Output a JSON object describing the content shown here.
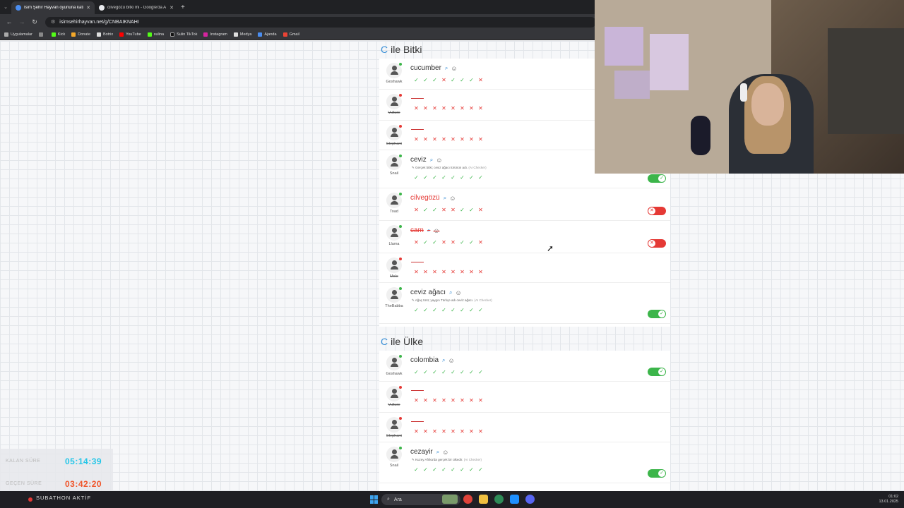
{
  "browser": {
    "tabs": [
      {
        "title": "İsim Şehir Hayvan oyununa katı",
        "active": true
      },
      {
        "title": "cilvegözü bitki mi - Google'da A",
        "active": false
      }
    ],
    "url": "isimsehirhayvan.net/g/CNBAIKNAHI",
    "bookmarks": [
      "Uygulamalar",
      "Kick",
      "Donate",
      "Botrix",
      "YouTube",
      "sulina",
      "Sulin TikTok",
      "Instagram",
      "Medya",
      "Ajanda",
      "Gmail"
    ]
  },
  "sections": [
    {
      "letter": "C",
      "title": "ile Bitki",
      "rows": [
        {
          "player": "Goshawk",
          "online": true,
          "answer": "cucumber",
          "style": "normal",
          "note": "",
          "votes": [
            "ok",
            "ok",
            "ok",
            "no",
            "ok",
            "ok",
            "ok",
            "no"
          ],
          "toggle": null,
          "struck": false
        },
        {
          "player": "Vulture",
          "online": false,
          "answer": "",
          "style": "empty",
          "note": "",
          "votes": [
            "no",
            "no",
            "no",
            "no",
            "no",
            "no",
            "no",
            "no"
          ],
          "toggle": null,
          "struck": true
        },
        {
          "player": "Elephant",
          "online": false,
          "answer": "",
          "style": "empty",
          "note": "",
          "votes": [
            "no",
            "no",
            "no",
            "no",
            "no",
            "no",
            "no",
            "no"
          ],
          "toggle": null,
          "struck": true
        },
        {
          "player": "Snail",
          "online": true,
          "answer": "ceviz",
          "style": "normal",
          "note": "Gerçek bitki; ceviz ağacı türünün adı.",
          "note_tag": "(AI Checker)",
          "votes": [
            "ok",
            "ok",
            "ok",
            "ok",
            "ok",
            "ok",
            "ok",
            "ok"
          ],
          "toggle": "on",
          "struck": false
        },
        {
          "player": "Toad",
          "online": true,
          "answer": "cilvegözü",
          "style": "red",
          "note": "",
          "votes": [
            "no",
            "ok",
            "ok",
            "no",
            "no",
            "ok",
            "ok",
            "no"
          ],
          "toggle": "off",
          "struck": false
        },
        {
          "player": "Llama",
          "online": true,
          "answer": "cam",
          "style": "strike",
          "note": "",
          "votes": [
            "no",
            "ok",
            "ok",
            "no",
            "no",
            "ok",
            "ok",
            "no"
          ],
          "toggle": "off",
          "struck": false
        },
        {
          "player": "Mole",
          "online": false,
          "answer": "",
          "style": "empty",
          "note": "",
          "votes": [
            "no",
            "no",
            "no",
            "no",
            "no",
            "no",
            "no",
            "no"
          ],
          "toggle": null,
          "struck": true
        },
        {
          "player": "TheBabba",
          "online": true,
          "answer": "ceviz ağacı",
          "style": "normal",
          "note": "Ağaç türü; yaygın Türkçe adı ceviz ağacı.",
          "note_tag": "(AI Checker)",
          "votes": [
            "ok",
            "ok",
            "ok",
            "ok",
            "ok",
            "ok",
            "ok",
            "ok"
          ],
          "toggle": "on",
          "struck": false
        }
      ]
    },
    {
      "letter": "C",
      "title": "ile Ülke",
      "rows": [
        {
          "player": "Goshawk",
          "online": true,
          "answer": "colombia",
          "style": "normal",
          "note": "",
          "votes": [
            "ok",
            "ok",
            "ok",
            "ok",
            "ok",
            "ok",
            "ok",
            "ok"
          ],
          "toggle": "on",
          "struck": false
        },
        {
          "player": "Vulture",
          "online": false,
          "answer": "",
          "style": "empty",
          "note": "",
          "votes": [
            "no",
            "no",
            "no",
            "no",
            "no",
            "no",
            "no",
            "no"
          ],
          "toggle": null,
          "struck": true
        },
        {
          "player": "Elephant",
          "online": false,
          "answer": "",
          "style": "empty",
          "note": "",
          "votes": [
            "no",
            "no",
            "no",
            "no",
            "no",
            "no",
            "no",
            "no"
          ],
          "toggle": null,
          "struck": true
        },
        {
          "player": "Snail",
          "online": true,
          "answer": "cezayir",
          "style": "normal",
          "note": "Kuzey Afrika'da gerçek bir ülkedir.",
          "note_tag": "(AI Checker)",
          "votes": [
            "ok",
            "ok",
            "ok",
            "ok",
            "ok",
            "ok",
            "ok",
            "ok"
          ],
          "toggle": "on",
          "struck": false
        }
      ]
    }
  ],
  "overlay": {
    "remaining_label": "KALAN SÜRE",
    "remaining_value": "05:14:39",
    "elapsed_label": "GEÇEN SÜRE",
    "elapsed_value": "03:42:20",
    "subathon": "SUBATHON AKTİF"
  },
  "taskbar": {
    "search_placeholder": "Ara",
    "time": "01:02",
    "date": "13.01.2025"
  },
  "colors": {
    "accent": "#3a8fd6",
    "ok": "#3cb54a",
    "no": "#e53935",
    "remaining": "#25c6e8",
    "elapsed": "#f0552a"
  }
}
